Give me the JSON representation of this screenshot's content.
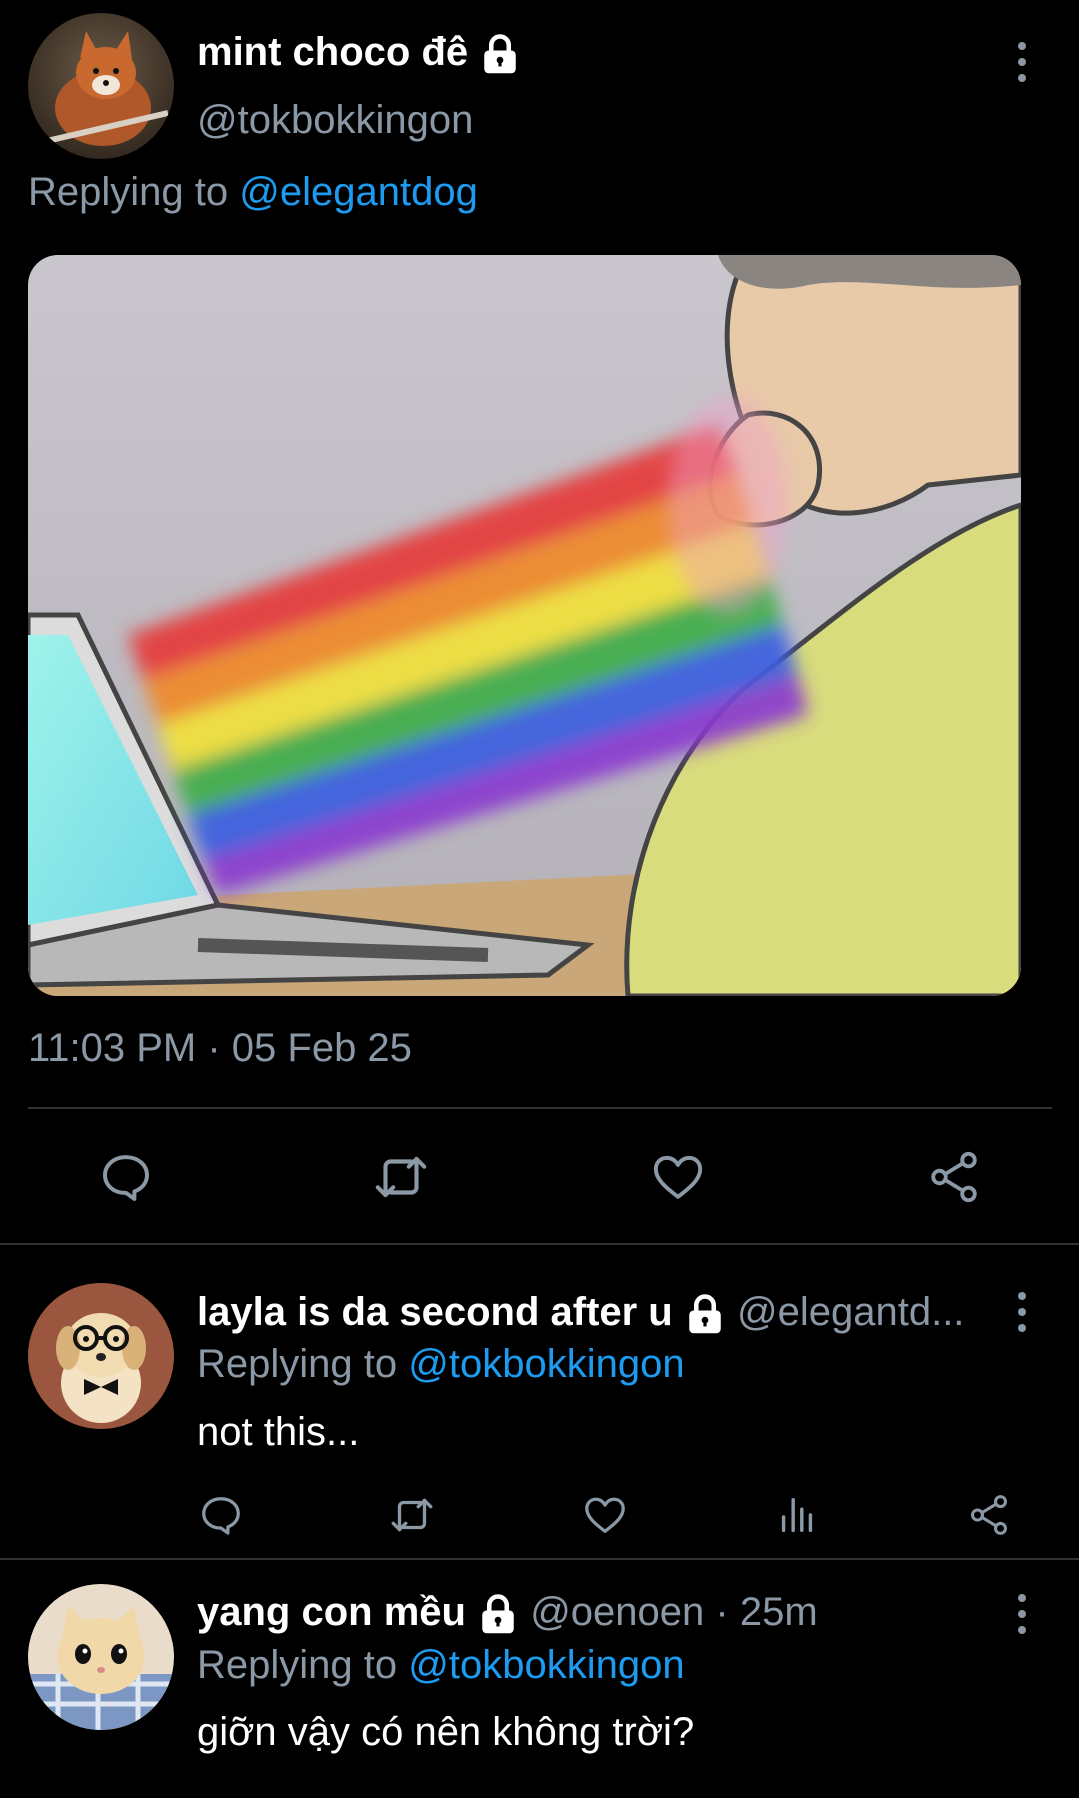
{
  "main_tweet": {
    "display_name": "mint choco đê",
    "handle": "@tokbokkingon",
    "replying_prefix": "Replying to",
    "replying_handle": "@elegantdog",
    "timestamp": "11:03 PM · 05 Feb 25",
    "icons": [
      "lock-icon",
      "more-icon",
      "reply-icon",
      "retweet-icon",
      "like-icon",
      "share-icon"
    ]
  },
  "replies": [
    {
      "display_name": "layla is da second after u",
      "handle": "@elegantd...",
      "replying_prefix": "Replying to",
      "replying_handle": "@tokbokkingon",
      "text": "not this..."
    },
    {
      "display_name": "yang con mều",
      "handle": "@oenoen",
      "time": "· 25m",
      "replying_prefix": "Replying to",
      "replying_handle": "@tokbokkingon",
      "text": "giỡn vậy có nên không trời?"
    }
  ],
  "colors": {
    "background": "#000000",
    "text": "#e7e9ea",
    "muted": "#8b98a5",
    "link": "#1d9bf0",
    "divider": "#2f3336"
  }
}
